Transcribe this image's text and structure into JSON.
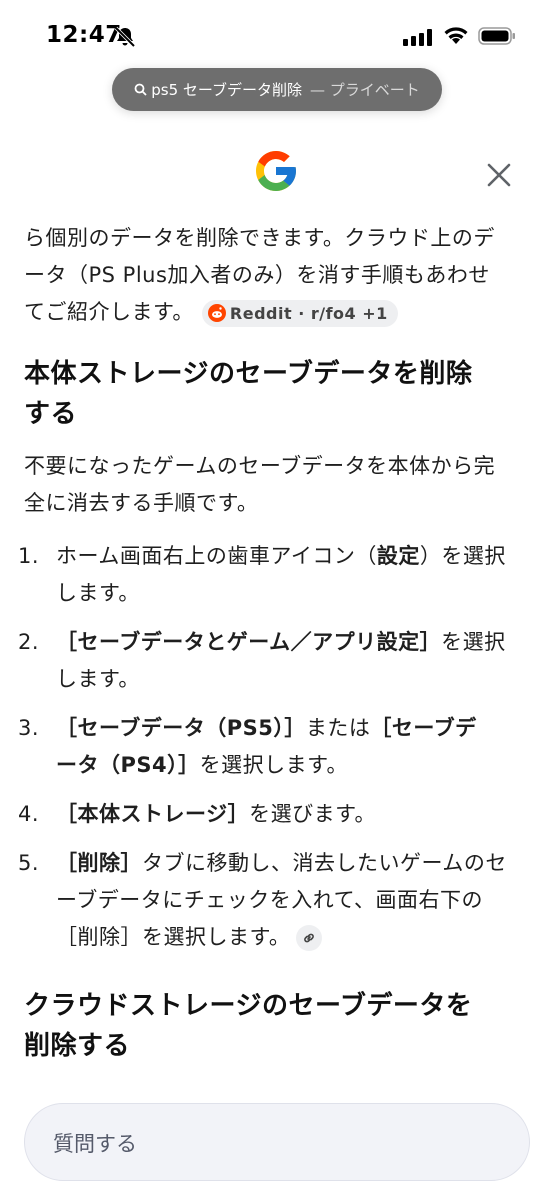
{
  "status_bar": {
    "time": "12:47"
  },
  "url_bar": {
    "query": "ps5 セーブデータ削除",
    "mode": "— プライベート"
  },
  "article": {
    "intro_lines": [
      "ら個別のデータを削除できます。クラウド上のデ",
      "ータ（PS Plus加入者のみ）を消す手順もあわせ",
      "てご紹介します。"
    ],
    "source_chip": "Reddit · r/fo4 +1",
    "heading1_lines": [
      "本体ストレージのセーブデータを削除",
      "する"
    ],
    "para2_lines": [
      "不要になったゲームのセーブデータを本体から完",
      "全に消去する手順です。"
    ],
    "steps": [
      {
        "num": "1.",
        "lines": [
          [
            "ホーム画面右上の歯車アイコン（",
            "設定",
            "）を選択"
          ],
          [
            "します。"
          ]
        ]
      },
      {
        "num": "2.",
        "lines": [
          [
            "",
            "［セーブデータとゲーム／アプリ設定］",
            "を選択"
          ],
          [
            "します。"
          ]
        ]
      },
      {
        "num": "3.",
        "lines": [
          [
            "",
            "［セーブデータ（PS5）］",
            "または",
            "［セーブデ"
          ],
          [
            "",
            "ータ（PS4）］",
            "を選択します。"
          ]
        ]
      },
      {
        "num": "4.",
        "lines": [
          [
            "",
            "［本体ストレージ］",
            "を選びます。"
          ]
        ]
      },
      {
        "num": "5.",
        "lines": [
          [
            "",
            "［削除］",
            "タブに移動し、消去したいゲームのセ"
          ],
          [
            "ーブデータにチェックを入れて、画面右下の"
          ],
          [
            "［削除］を選択します。"
          ]
        ]
      }
    ],
    "heading2_lines": [
      "クラウドストレージのセーブデータを",
      "削除する"
    ]
  },
  "ask_bar": {
    "placeholder": "質問する"
  },
  "colors": {
    "url_bar_bg": "#6e6e6e",
    "chip_bg": "#eeeff1",
    "ask_bg": "#f2f3f8",
    "reddit": "#ff4500"
  }
}
